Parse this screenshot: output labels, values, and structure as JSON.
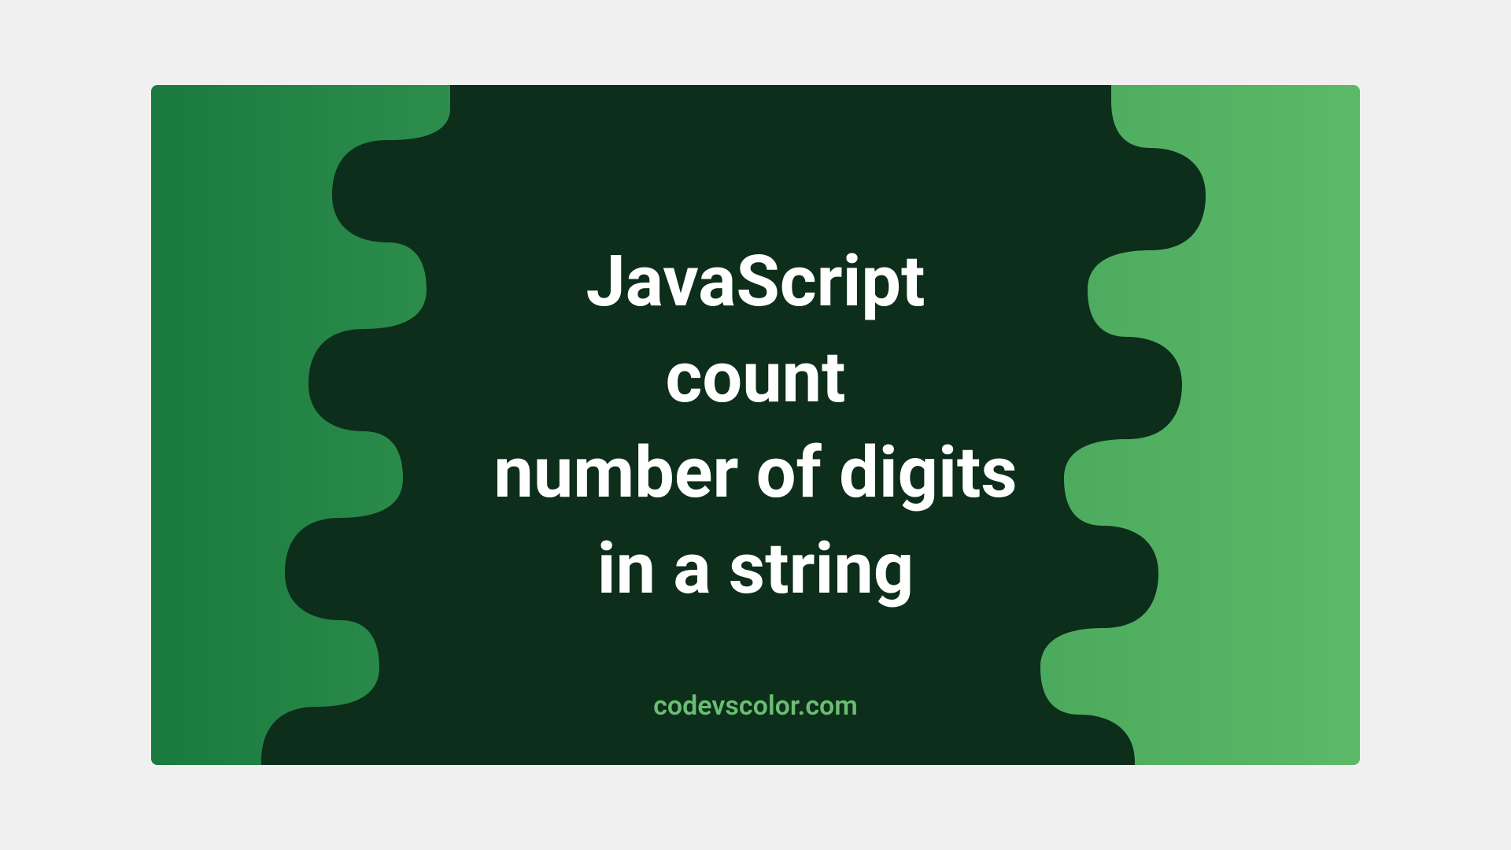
{
  "title_lines": {
    "line1": "JavaScript",
    "line2": "count",
    "line3": "number of digits",
    "line4": "in a string"
  },
  "attribution": "codevscolor.com",
  "colors": {
    "blob": "#0d2e1a",
    "gradient_start": "#1a7a3f",
    "gradient_end": "#5cb968",
    "text": "#ffffff",
    "attribution": "#6abd72"
  }
}
